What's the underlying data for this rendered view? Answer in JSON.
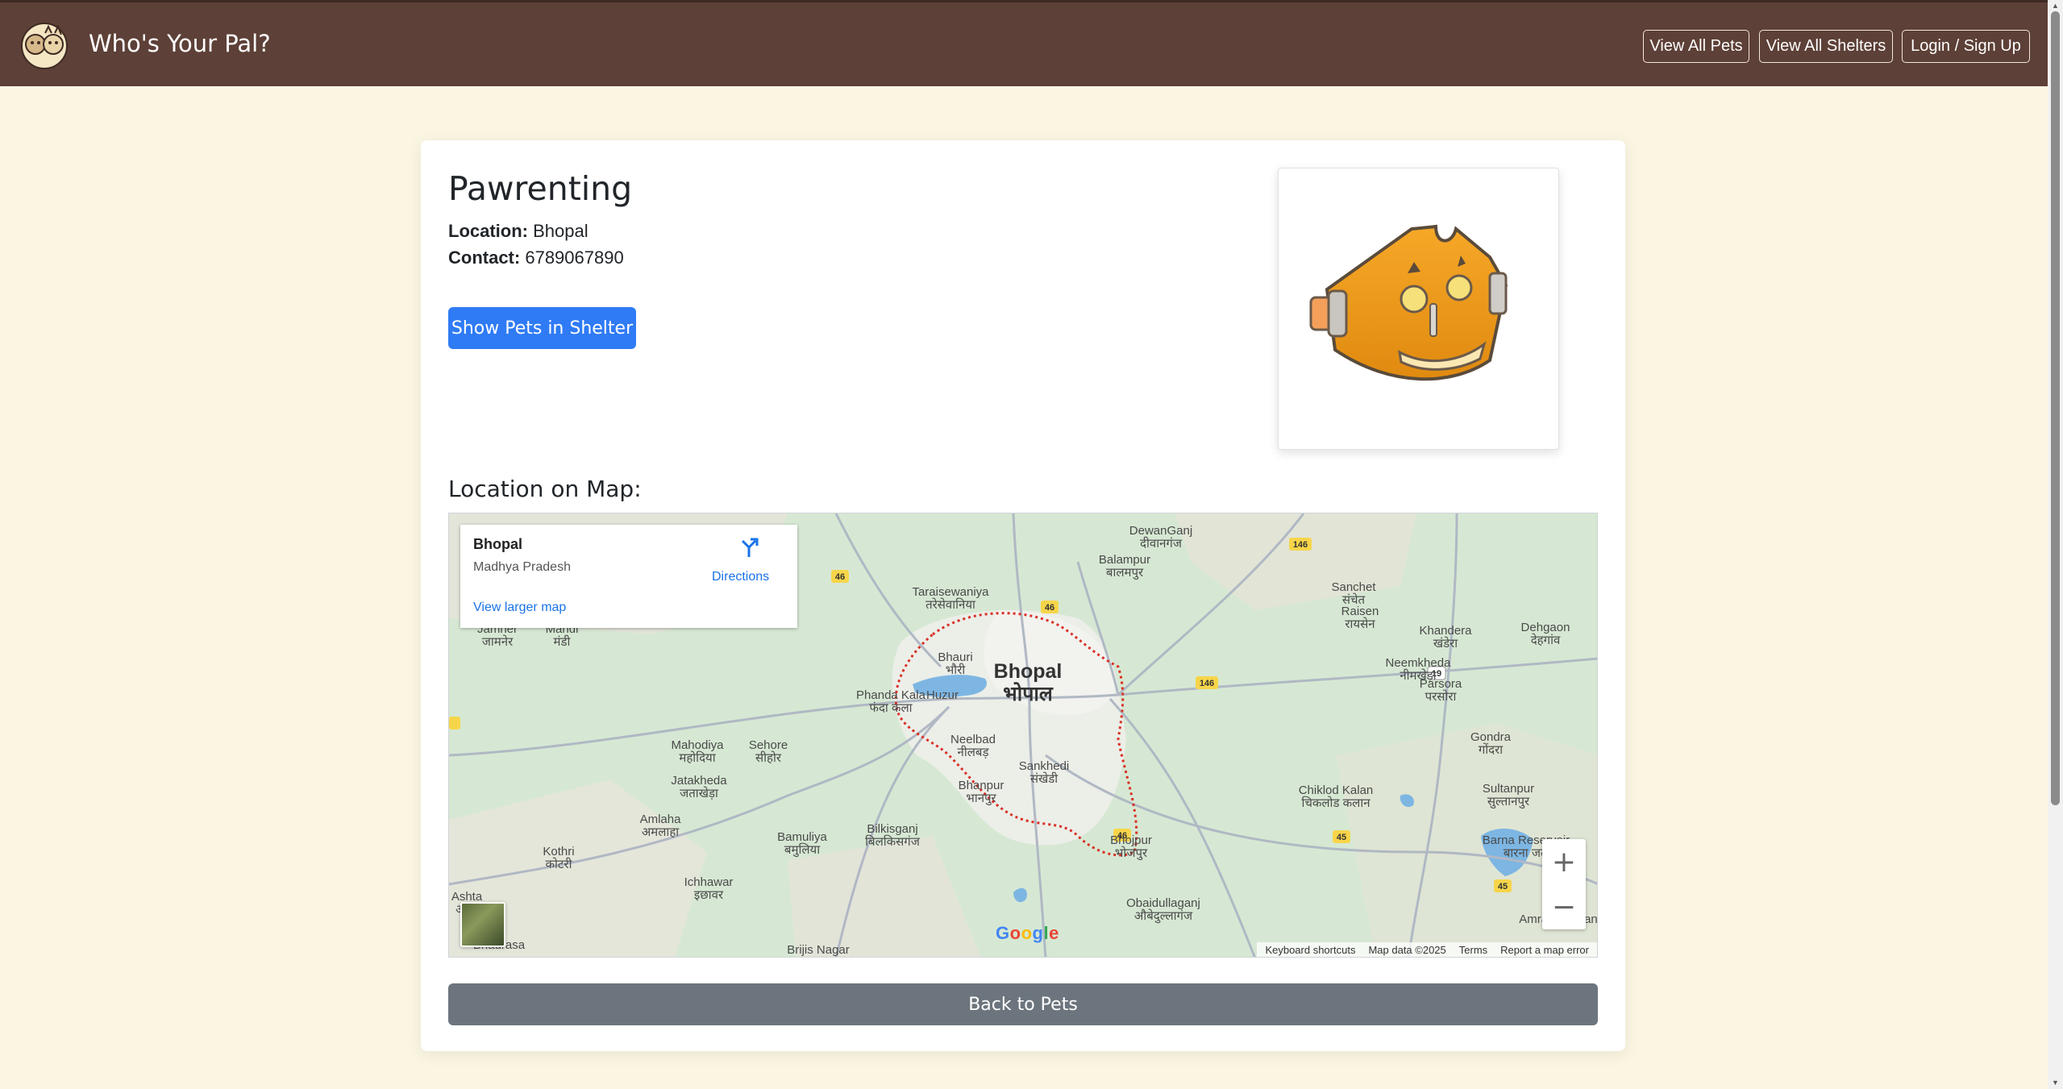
{
  "navbar": {
    "brand": "Who's Your Pal?",
    "links": [
      "View All Pets",
      "View All Shelters",
      "Login / Sign Up"
    ]
  },
  "shelter": {
    "name": "Pawrenting",
    "location_label": "Location:",
    "location": "Bhopal",
    "contact_label": "Contact:",
    "contact": "6789067890",
    "show_pets_label": "Show Pets in Shelter"
  },
  "map_section": {
    "heading": "Location on Map:",
    "infobox": {
      "title": "Bhopal",
      "subtitle": "Madhya Pradesh",
      "directions": "Directions",
      "larger_map": "View larger map"
    },
    "footer": [
      "Keyboard shortcuts",
      "Map data ©2025",
      "Terms",
      "Report a map error"
    ],
    "google": "Google",
    "city_label": "Bhopal",
    "city_label_hi": "भोपाल",
    "places": [
      {
        "name": "DewanGanj",
        "hi": "दीवानगंज"
      },
      {
        "name": "Balampur",
        "hi": "बालमपुर"
      },
      {
        "name": "Taraisewaniya",
        "hi": "तरेसेवानिया"
      },
      {
        "name": "Sanchet",
        "hi": "संचेत"
      },
      {
        "name": "Raisen",
        "hi": "रायसेन"
      },
      {
        "name": "Khandera",
        "hi": "खंडेरा"
      },
      {
        "name": "Dehgaon",
        "hi": "देहगांव"
      },
      {
        "name": "Neemkheda",
        "hi": "नीमखेड़ा"
      },
      {
        "name": "Parsora",
        "hi": "परसोरा"
      },
      {
        "name": "Gondra",
        "hi": "गोंदरा"
      },
      {
        "name": "Bhauri",
        "hi": "भौरी"
      },
      {
        "name": "Phanda Kala",
        "hi": "फंदा कला"
      },
      {
        "name": "Huzur",
        "hi": ""
      },
      {
        "name": "Neelbad",
        "hi": "नीलबड़"
      },
      {
        "name": "Sankhedi",
        "hi": "संखेडी"
      },
      {
        "name": "Bhanpur",
        "hi": "भानपुर"
      },
      {
        "name": "Bhojpur",
        "hi": "भोजपुर"
      },
      {
        "name": "Chiklod Kalan",
        "hi": "चिकलोड कलान"
      },
      {
        "name": "Sultanpur",
        "hi": "सुल्तानपुर"
      },
      {
        "name": "Barna Reservoir",
        "hi": "बारना जल"
      },
      {
        "name": "Mahodiya",
        "hi": "महोदिया"
      },
      {
        "name": "Sehore",
        "hi": "सीहोर"
      },
      {
        "name": "Jatakheda",
        "hi": "जताखेड़ा"
      },
      {
        "name": "Amlaha",
        "hi": "अमलाहा"
      },
      {
        "name": "Bamuliya",
        "hi": "बमुलिया"
      },
      {
        "name": "Bilkisganj",
        "hi": "बिलकिसगंज"
      },
      {
        "name": "Kothri",
        "hi": "कोटरी"
      },
      {
        "name": "Ichhawar",
        "hi": "इछावर"
      },
      {
        "name": "Obaidullaganj",
        "hi": "औबेदुल्लागंज"
      },
      {
        "name": "Ashta",
        "hi": "आष्टा"
      },
      {
        "name": "Bhaurasa",
        "hi": ""
      },
      {
        "name": "Brijis Nagar",
        "hi": ""
      },
      {
        "name": "Amrawa Kalan",
        "hi": ""
      },
      {
        "name": "Jamner",
        "hi": "जामनेर"
      },
      {
        "name": "Mandi",
        "hi": "मंडी"
      }
    ],
    "highways": [
      "146",
      "46",
      "46",
      "146",
      "19",
      "46",
      "45",
      "45",
      "46"
    ],
    "colors": {
      "map_bg": "#d6e8d3",
      "water": "#7db6e3",
      "road": "#b0b8c4",
      "boundary": "#d93025"
    }
  },
  "back_label": "Back to Pets",
  "colors": {
    "navbar": "#5d4037",
    "page_bg": "#fbf6e2",
    "primary": "#2f7bf5",
    "secondary": "#6c757d"
  }
}
